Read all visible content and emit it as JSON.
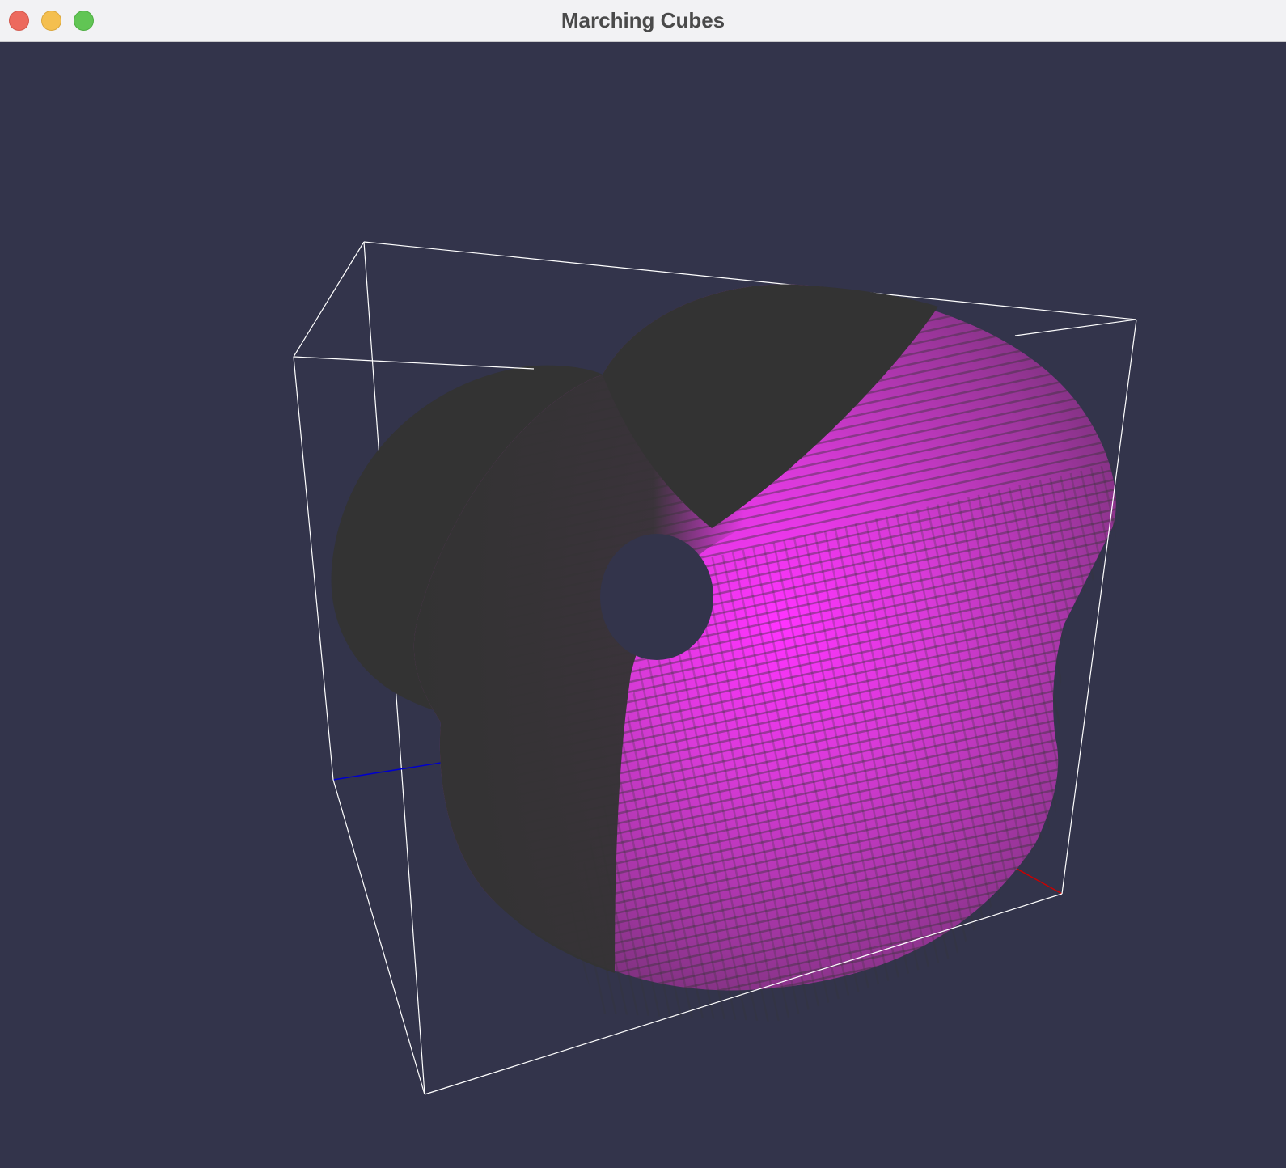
{
  "window": {
    "title": "Marching Cubes"
  },
  "colors": {
    "background": "#33344b",
    "surface_dark": "#333333",
    "surface_highlight": "#ff33ff",
    "surface_mid": "#a035a0",
    "bounding_box": "#ffffff",
    "axis_x": "#cc0000",
    "axis_z": "#0000cc"
  },
  "icons": [
    "close-button",
    "minimize-button",
    "zoom-button"
  ]
}
